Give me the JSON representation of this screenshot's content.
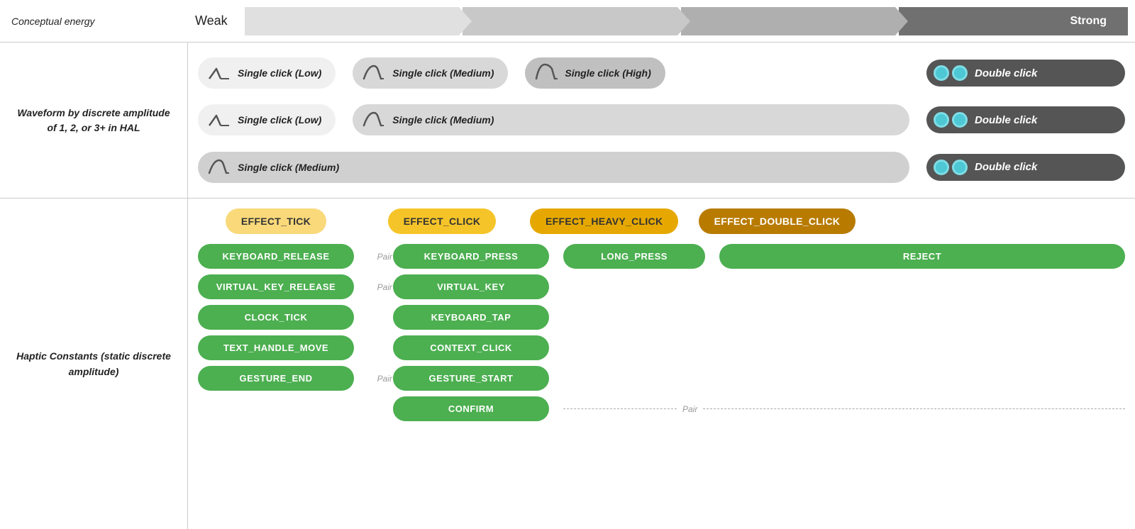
{
  "energy": {
    "label": "Conceptual energy",
    "weak": "Weak",
    "strong": "Strong"
  },
  "waveform": {
    "label": "Waveform by discrete amplitude of 1, 2, or 3+ in HAL",
    "rows": [
      {
        "pills": [
          {
            "type": "light",
            "label": "Single click (Low)"
          },
          {
            "type": "medium",
            "label": "Single click (Medium)"
          },
          {
            "type": "high",
            "label": "Single click (High)"
          }
        ],
        "double": "Double click"
      },
      {
        "pills": [
          {
            "type": "light",
            "label": "Single click (Low)"
          },
          {
            "type": "medium",
            "label": "Single click (Medium)"
          }
        ],
        "double": "Double click"
      },
      {
        "pills": [
          {
            "type": "medium-only",
            "label": "Single click (Medium)"
          }
        ],
        "double": "Double click"
      }
    ]
  },
  "haptic": {
    "label": "Haptic Constants (static discrete amplitude)",
    "effects": {
      "tick": "EFFECT_TICK",
      "click": "EFFECT_CLICK",
      "heavy_click": "EFFECT_HEAVY_CLICK",
      "double_click": "EFFECT_DOUBLE_CLICK"
    },
    "col1": {
      "items": [
        "KEYBOARD_RELEASE",
        "VIRTUAL_KEY_RELEASE",
        "CLOCK_TICK",
        "TEXT_HANDLE_MOVE",
        "GESTURE_END"
      ]
    },
    "col2": {
      "items": [
        "KEYBOARD_PRESS",
        "VIRTUAL_KEY",
        "KEYBOARD_TAP",
        "CONTEXT_CLICK",
        "GESTURE_START"
      ]
    },
    "col3": {
      "items": [
        "LONG_PRESS"
      ]
    },
    "col4": {
      "items": [
        "REJECT"
      ]
    },
    "confirm": "CONFIRM",
    "pair_label": "Pair",
    "pair_label2": "Pair",
    "pair_label3": "Pair",
    "pair_label4": "Pair"
  }
}
